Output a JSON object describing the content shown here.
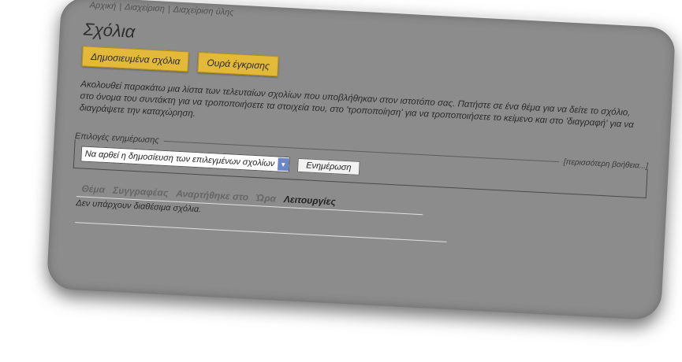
{
  "breadcrumb": [
    "Αρχική",
    "Διαχείριση",
    "Διαχείριση ύλης"
  ],
  "page_title": "Σχόλια",
  "tabs": [
    {
      "label": "Δημοσιευμένα σχόλια"
    },
    {
      "label": "Ουρά έγκρισης"
    }
  ],
  "description": "Ακολουθεί παρακάτω μια λίστα των τελευταίων σχολίων που υποβλήθηκαν στον ιστοτόπο σας. Πατήστε σε ένα θέμα για να δείτε το σχόλιο, στο όνομα του συντάκτη για να τροποποιήσετε τα στοιχεία του, στο 'τροποποίηση' για να τροποποιήσετε το κείμενο και στο 'διαγραφή' για να διαγράψετε την καταχώρηση.",
  "update_options": {
    "legend": "Επιλογές ενημέρωσης",
    "help_link": "[περισσότερη βοήθεια...]",
    "select_value": "Να αρθεί η δημοσίευση των επιλεγμένων σχολίων",
    "button_label": "Ενημέρωση"
  },
  "table": {
    "headers": [
      "Θέμα",
      "Συγγραφέας",
      "Αναρτήθηκε στο",
      "Ώρα",
      "Λειτουργίες"
    ],
    "empty_text": "Δεν υπάρχουν διαθέσιμα σχόλια."
  }
}
